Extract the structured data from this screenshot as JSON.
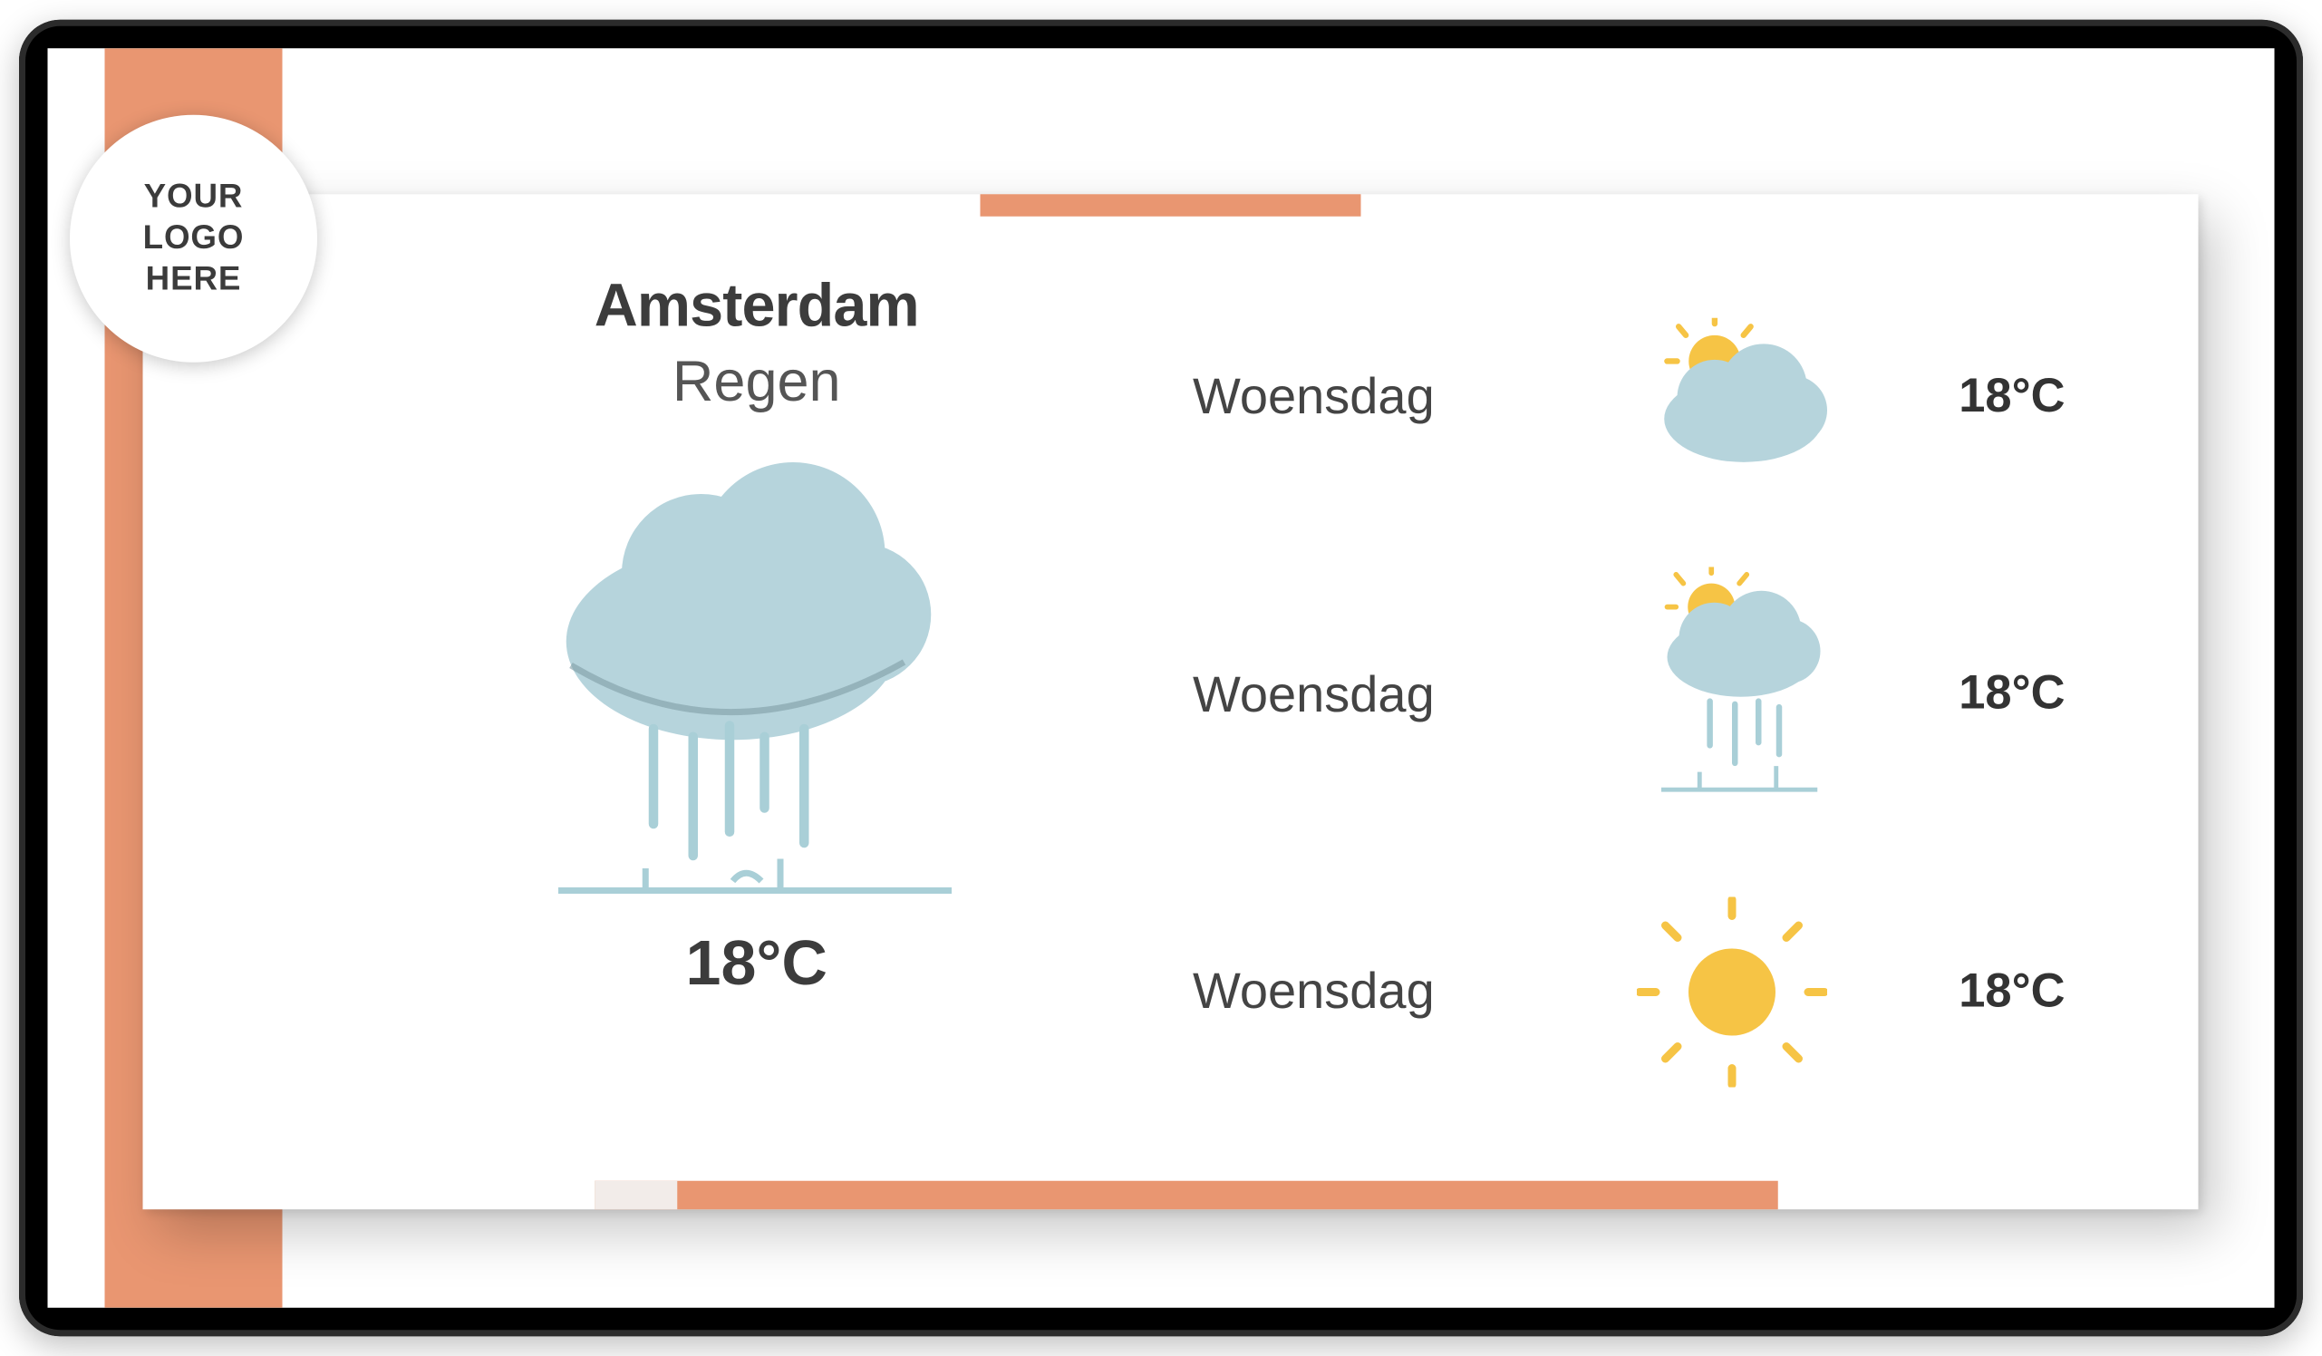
{
  "logo_text": "YOUR\nLOGO\nHERE",
  "colors": {
    "accent": "#e99671",
    "cloud": "#b6d4dc",
    "cloud_shadow": "#8ca9b0",
    "sun": "#f6c445",
    "rain": "#a9cfd7",
    "text_dark": "#3c3c3c"
  },
  "current": {
    "city": "Amsterdam",
    "condition": "Regen",
    "temperature": "18°C",
    "icon": "rain"
  },
  "forecast": [
    {
      "day": "Woensdag",
      "icon": "partly-cloudy",
      "temperature": "18°C"
    },
    {
      "day": "Woensdag",
      "icon": "sun-rain",
      "temperature": "18°C"
    },
    {
      "day": "Woensdag",
      "icon": "sunny",
      "temperature": "18°C"
    }
  ]
}
